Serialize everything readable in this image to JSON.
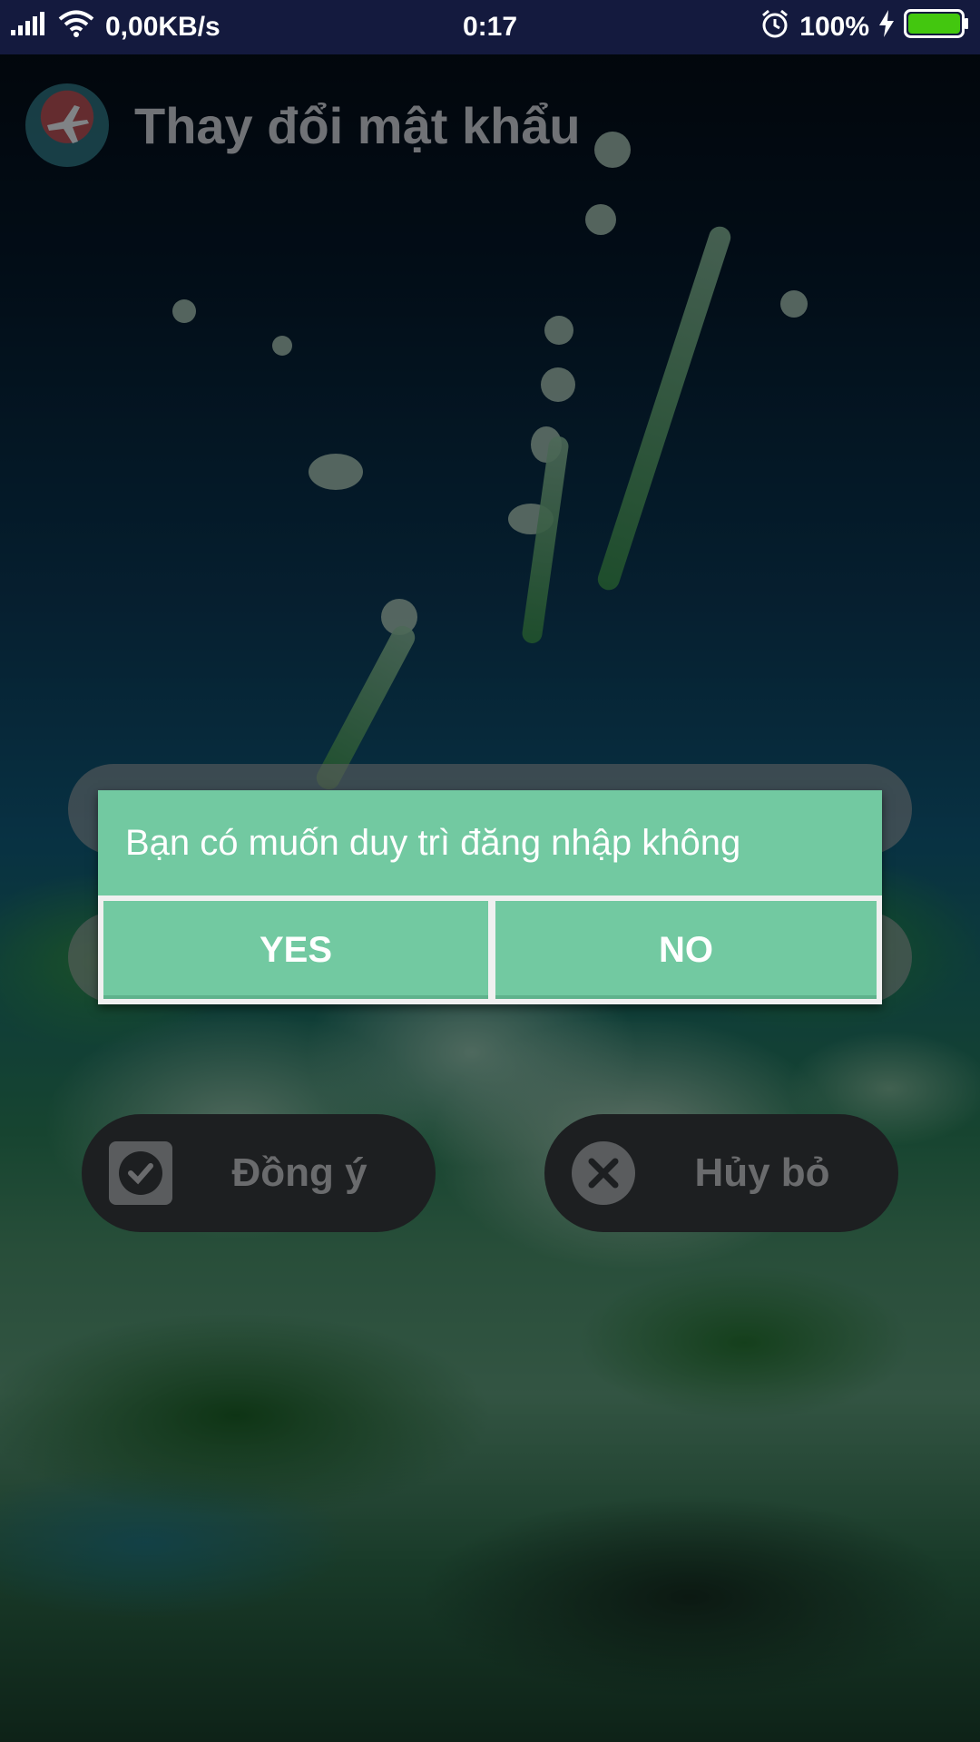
{
  "status_bar": {
    "network_speed": "0,00KB/s",
    "time": "0:17",
    "battery_percent": "100%",
    "icons": [
      "signal-icon",
      "wifi-icon",
      "alarm-icon",
      "charging-icon",
      "battery-icon"
    ]
  },
  "header": {
    "title": "Thay đổi mật khẩu"
  },
  "actions": {
    "confirm_label": "Đồng ý",
    "cancel_label": "Hủy bỏ"
  },
  "dialog": {
    "message": "Bạn có muốn duy trì đăng nhập không",
    "yes_label": "YES",
    "no_label": "NO"
  },
  "colors": {
    "status_bar_bg": "#141a3e",
    "dialog_green": "#72c9a1",
    "button_dark": "#1d1f21",
    "battery_green": "#43c70f"
  }
}
